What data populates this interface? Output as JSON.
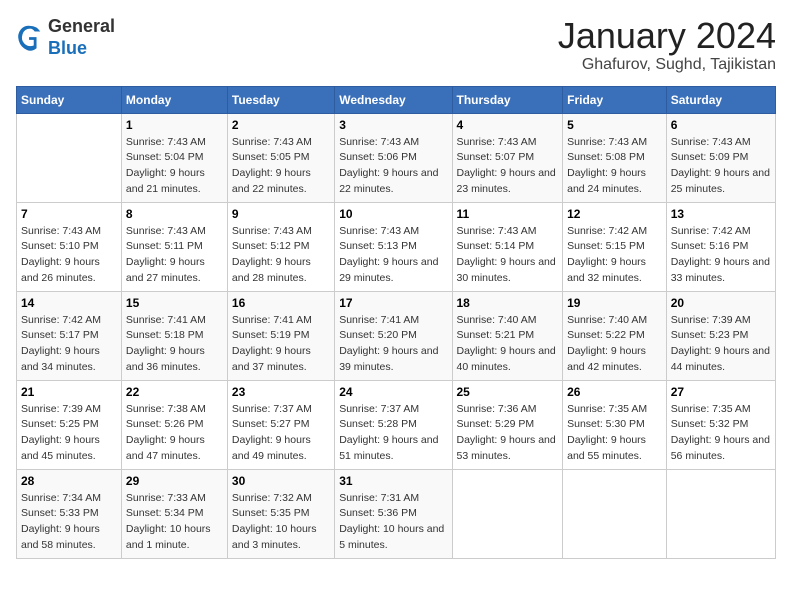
{
  "logo": {
    "general": "General",
    "blue": "Blue"
  },
  "title": "January 2024",
  "subtitle": "Ghafurov, Sughd, Tajikistan",
  "days_of_week": [
    "Sunday",
    "Monday",
    "Tuesday",
    "Wednesday",
    "Thursday",
    "Friday",
    "Saturday"
  ],
  "weeks": [
    [
      {
        "day": "",
        "sunrise": "",
        "sunset": "",
        "daylight": ""
      },
      {
        "day": "1",
        "sunrise": "Sunrise: 7:43 AM",
        "sunset": "Sunset: 5:04 PM",
        "daylight": "Daylight: 9 hours and 21 minutes."
      },
      {
        "day": "2",
        "sunrise": "Sunrise: 7:43 AM",
        "sunset": "Sunset: 5:05 PM",
        "daylight": "Daylight: 9 hours and 22 minutes."
      },
      {
        "day": "3",
        "sunrise": "Sunrise: 7:43 AM",
        "sunset": "Sunset: 5:06 PM",
        "daylight": "Daylight: 9 hours and 22 minutes."
      },
      {
        "day": "4",
        "sunrise": "Sunrise: 7:43 AM",
        "sunset": "Sunset: 5:07 PM",
        "daylight": "Daylight: 9 hours and 23 minutes."
      },
      {
        "day": "5",
        "sunrise": "Sunrise: 7:43 AM",
        "sunset": "Sunset: 5:08 PM",
        "daylight": "Daylight: 9 hours and 24 minutes."
      },
      {
        "day": "6",
        "sunrise": "Sunrise: 7:43 AM",
        "sunset": "Sunset: 5:09 PM",
        "daylight": "Daylight: 9 hours and 25 minutes."
      }
    ],
    [
      {
        "day": "7",
        "sunrise": "Sunrise: 7:43 AM",
        "sunset": "Sunset: 5:10 PM",
        "daylight": "Daylight: 9 hours and 26 minutes."
      },
      {
        "day": "8",
        "sunrise": "Sunrise: 7:43 AM",
        "sunset": "Sunset: 5:11 PM",
        "daylight": "Daylight: 9 hours and 27 minutes."
      },
      {
        "day": "9",
        "sunrise": "Sunrise: 7:43 AM",
        "sunset": "Sunset: 5:12 PM",
        "daylight": "Daylight: 9 hours and 28 minutes."
      },
      {
        "day": "10",
        "sunrise": "Sunrise: 7:43 AM",
        "sunset": "Sunset: 5:13 PM",
        "daylight": "Daylight: 9 hours and 29 minutes."
      },
      {
        "day": "11",
        "sunrise": "Sunrise: 7:43 AM",
        "sunset": "Sunset: 5:14 PM",
        "daylight": "Daylight: 9 hours and 30 minutes."
      },
      {
        "day": "12",
        "sunrise": "Sunrise: 7:42 AM",
        "sunset": "Sunset: 5:15 PM",
        "daylight": "Daylight: 9 hours and 32 minutes."
      },
      {
        "day": "13",
        "sunrise": "Sunrise: 7:42 AM",
        "sunset": "Sunset: 5:16 PM",
        "daylight": "Daylight: 9 hours and 33 minutes."
      }
    ],
    [
      {
        "day": "14",
        "sunrise": "Sunrise: 7:42 AM",
        "sunset": "Sunset: 5:17 PM",
        "daylight": "Daylight: 9 hours and 34 minutes."
      },
      {
        "day": "15",
        "sunrise": "Sunrise: 7:41 AM",
        "sunset": "Sunset: 5:18 PM",
        "daylight": "Daylight: 9 hours and 36 minutes."
      },
      {
        "day": "16",
        "sunrise": "Sunrise: 7:41 AM",
        "sunset": "Sunset: 5:19 PM",
        "daylight": "Daylight: 9 hours and 37 minutes."
      },
      {
        "day": "17",
        "sunrise": "Sunrise: 7:41 AM",
        "sunset": "Sunset: 5:20 PM",
        "daylight": "Daylight: 9 hours and 39 minutes."
      },
      {
        "day": "18",
        "sunrise": "Sunrise: 7:40 AM",
        "sunset": "Sunset: 5:21 PM",
        "daylight": "Daylight: 9 hours and 40 minutes."
      },
      {
        "day": "19",
        "sunrise": "Sunrise: 7:40 AM",
        "sunset": "Sunset: 5:22 PM",
        "daylight": "Daylight: 9 hours and 42 minutes."
      },
      {
        "day": "20",
        "sunrise": "Sunrise: 7:39 AM",
        "sunset": "Sunset: 5:23 PM",
        "daylight": "Daylight: 9 hours and 44 minutes."
      }
    ],
    [
      {
        "day": "21",
        "sunrise": "Sunrise: 7:39 AM",
        "sunset": "Sunset: 5:25 PM",
        "daylight": "Daylight: 9 hours and 45 minutes."
      },
      {
        "day": "22",
        "sunrise": "Sunrise: 7:38 AM",
        "sunset": "Sunset: 5:26 PM",
        "daylight": "Daylight: 9 hours and 47 minutes."
      },
      {
        "day": "23",
        "sunrise": "Sunrise: 7:37 AM",
        "sunset": "Sunset: 5:27 PM",
        "daylight": "Daylight: 9 hours and 49 minutes."
      },
      {
        "day": "24",
        "sunrise": "Sunrise: 7:37 AM",
        "sunset": "Sunset: 5:28 PM",
        "daylight": "Daylight: 9 hours and 51 minutes."
      },
      {
        "day": "25",
        "sunrise": "Sunrise: 7:36 AM",
        "sunset": "Sunset: 5:29 PM",
        "daylight": "Daylight: 9 hours and 53 minutes."
      },
      {
        "day": "26",
        "sunrise": "Sunrise: 7:35 AM",
        "sunset": "Sunset: 5:30 PM",
        "daylight": "Daylight: 9 hours and 55 minutes."
      },
      {
        "day": "27",
        "sunrise": "Sunrise: 7:35 AM",
        "sunset": "Sunset: 5:32 PM",
        "daylight": "Daylight: 9 hours and 56 minutes."
      }
    ],
    [
      {
        "day": "28",
        "sunrise": "Sunrise: 7:34 AM",
        "sunset": "Sunset: 5:33 PM",
        "daylight": "Daylight: 9 hours and 58 minutes."
      },
      {
        "day": "29",
        "sunrise": "Sunrise: 7:33 AM",
        "sunset": "Sunset: 5:34 PM",
        "daylight": "Daylight: 10 hours and 1 minute."
      },
      {
        "day": "30",
        "sunrise": "Sunrise: 7:32 AM",
        "sunset": "Sunset: 5:35 PM",
        "daylight": "Daylight: 10 hours and 3 minutes."
      },
      {
        "day": "31",
        "sunrise": "Sunrise: 7:31 AM",
        "sunset": "Sunset: 5:36 PM",
        "daylight": "Daylight: 10 hours and 5 minutes."
      },
      {
        "day": "",
        "sunrise": "",
        "sunset": "",
        "daylight": ""
      },
      {
        "day": "",
        "sunrise": "",
        "sunset": "",
        "daylight": ""
      },
      {
        "day": "",
        "sunrise": "",
        "sunset": "",
        "daylight": ""
      }
    ]
  ]
}
